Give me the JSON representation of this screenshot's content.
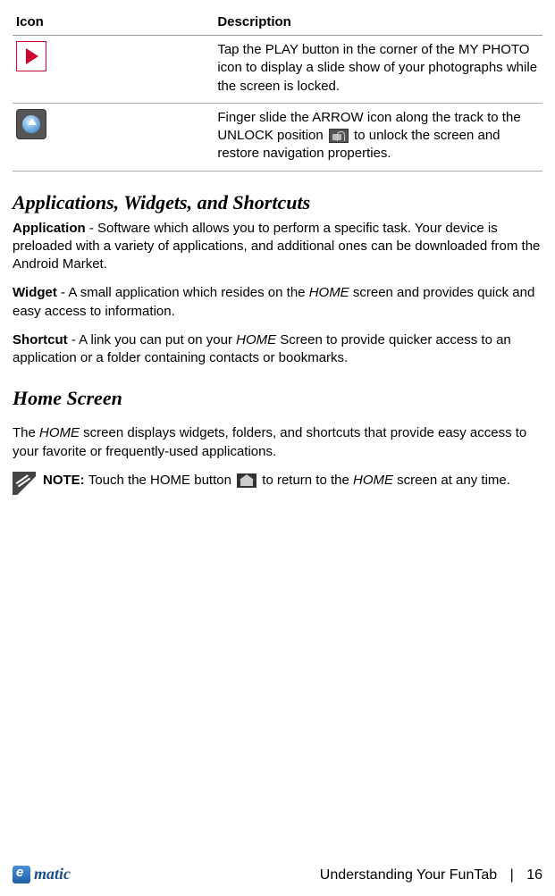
{
  "table": {
    "headers": {
      "icon": "Icon",
      "desc": "Description"
    },
    "rows": [
      {
        "icon_name": "play-icon",
        "desc": "Tap the PLAY button in the corner of the MY PHOTO icon to display a slide show of your photographs while the screen is locked."
      },
      {
        "icon_name": "arrow-up-icon",
        "desc_pre": "Finger slide the ARROW icon along the track to the UNLOCK position ",
        "desc_post": " to unlock the screen and restore navigation properties."
      }
    ]
  },
  "section1": {
    "heading": "Applications, Widgets, and Shortcuts",
    "application": {
      "label": "Application",
      "text": " - Software which allows you to perform a specific task. Your device is preloaded with a variety of applications, and additional ones can be downloaded from the Android Market."
    },
    "widget": {
      "label": "Widget",
      "text_pre": " - A small application which resides on the ",
      "text_home": "HOME",
      "text_post": " screen and provides quick and easy access to information."
    },
    "shortcut": {
      "label": "Shortcut",
      "text_pre": " - A link you can put on your ",
      "text_home": "HOME",
      "text_post": " Screen to provide quicker access to an application or a folder containing contacts or bookmarks."
    }
  },
  "section2": {
    "heading": "Home Screen",
    "intro_pre": "The ",
    "intro_home": "HOME",
    "intro_post": " screen displays widgets, folders, and shortcuts that provide easy access to your favorite or frequently-used applications.",
    "note_label": "NOTE: ",
    "note_pre": "Touch the HOME button ",
    "note_mid": " to return to the ",
    "note_home": "HOME",
    "note_post": " screen at any time."
  },
  "footer": {
    "logo_text": "matic",
    "chapter": "Understanding Your FunTab",
    "separator": "|",
    "page_number": "16"
  }
}
